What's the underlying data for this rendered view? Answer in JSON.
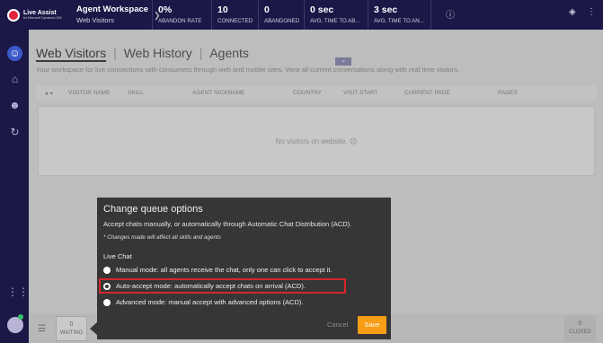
{
  "header": {
    "logo_line1": "Live Assist",
    "logo_line2": "for Microsoft Dynamics 365",
    "workspace_title": "Agent Workspace",
    "workspace_subtitle": "Web Visitors",
    "metrics": [
      {
        "value": "0%",
        "label": "ABANDON RATE"
      },
      {
        "value": "10",
        "label": "CONNECTED"
      },
      {
        "value": "0",
        "label": "ABANDONED"
      },
      {
        "value": "0 sec",
        "label": "AVG. TIME TO AB..."
      },
      {
        "value": "3 sec",
        "label": "AVG. TIME TO AN..."
      }
    ]
  },
  "tabs": [
    {
      "label": "Web Visitors"
    },
    {
      "label": "Web History"
    },
    {
      "label": "Agents"
    }
  ],
  "description": "Your workspace for live connections with consumers through web and mobile sites. View all current conversations along with real time visitors.",
  "table": {
    "columns": [
      "VISITOR NAME",
      "SKILL",
      "AGENT NICKNAME",
      "COUNTRY",
      "VISIT START",
      "CURRENT PAGE",
      "PAGES"
    ],
    "empty_message": "No visitors on website."
  },
  "bottom": {
    "waiting_count": "0",
    "waiting_label": "WAITING",
    "closed_count": "0",
    "closed_label": "CLOSED"
  },
  "popover": {
    "title": "Change queue options",
    "description": "Accept chats manually, or automatically through Automatic Chat Distribution (ACD).",
    "note": "* Changes made will affect all skills and agents",
    "section": "Live Chat",
    "options": [
      {
        "label": "Manual mode: all agents receive the chat, only one can click to accept it.",
        "selected": false
      },
      {
        "label": "Auto-accept mode: automatically accept chats on arrival (ACD).",
        "selected": true
      },
      {
        "label": "Advanced mode: manual accept with advanced options (ACD).",
        "selected": false
      }
    ],
    "cancel_label": "Cancel",
    "save_label": "Save"
  },
  "colors": {
    "nav_bg": "#1b1747",
    "accent": "#3b58c9",
    "save_button": "#f79e16",
    "highlight": "#d6262c"
  }
}
